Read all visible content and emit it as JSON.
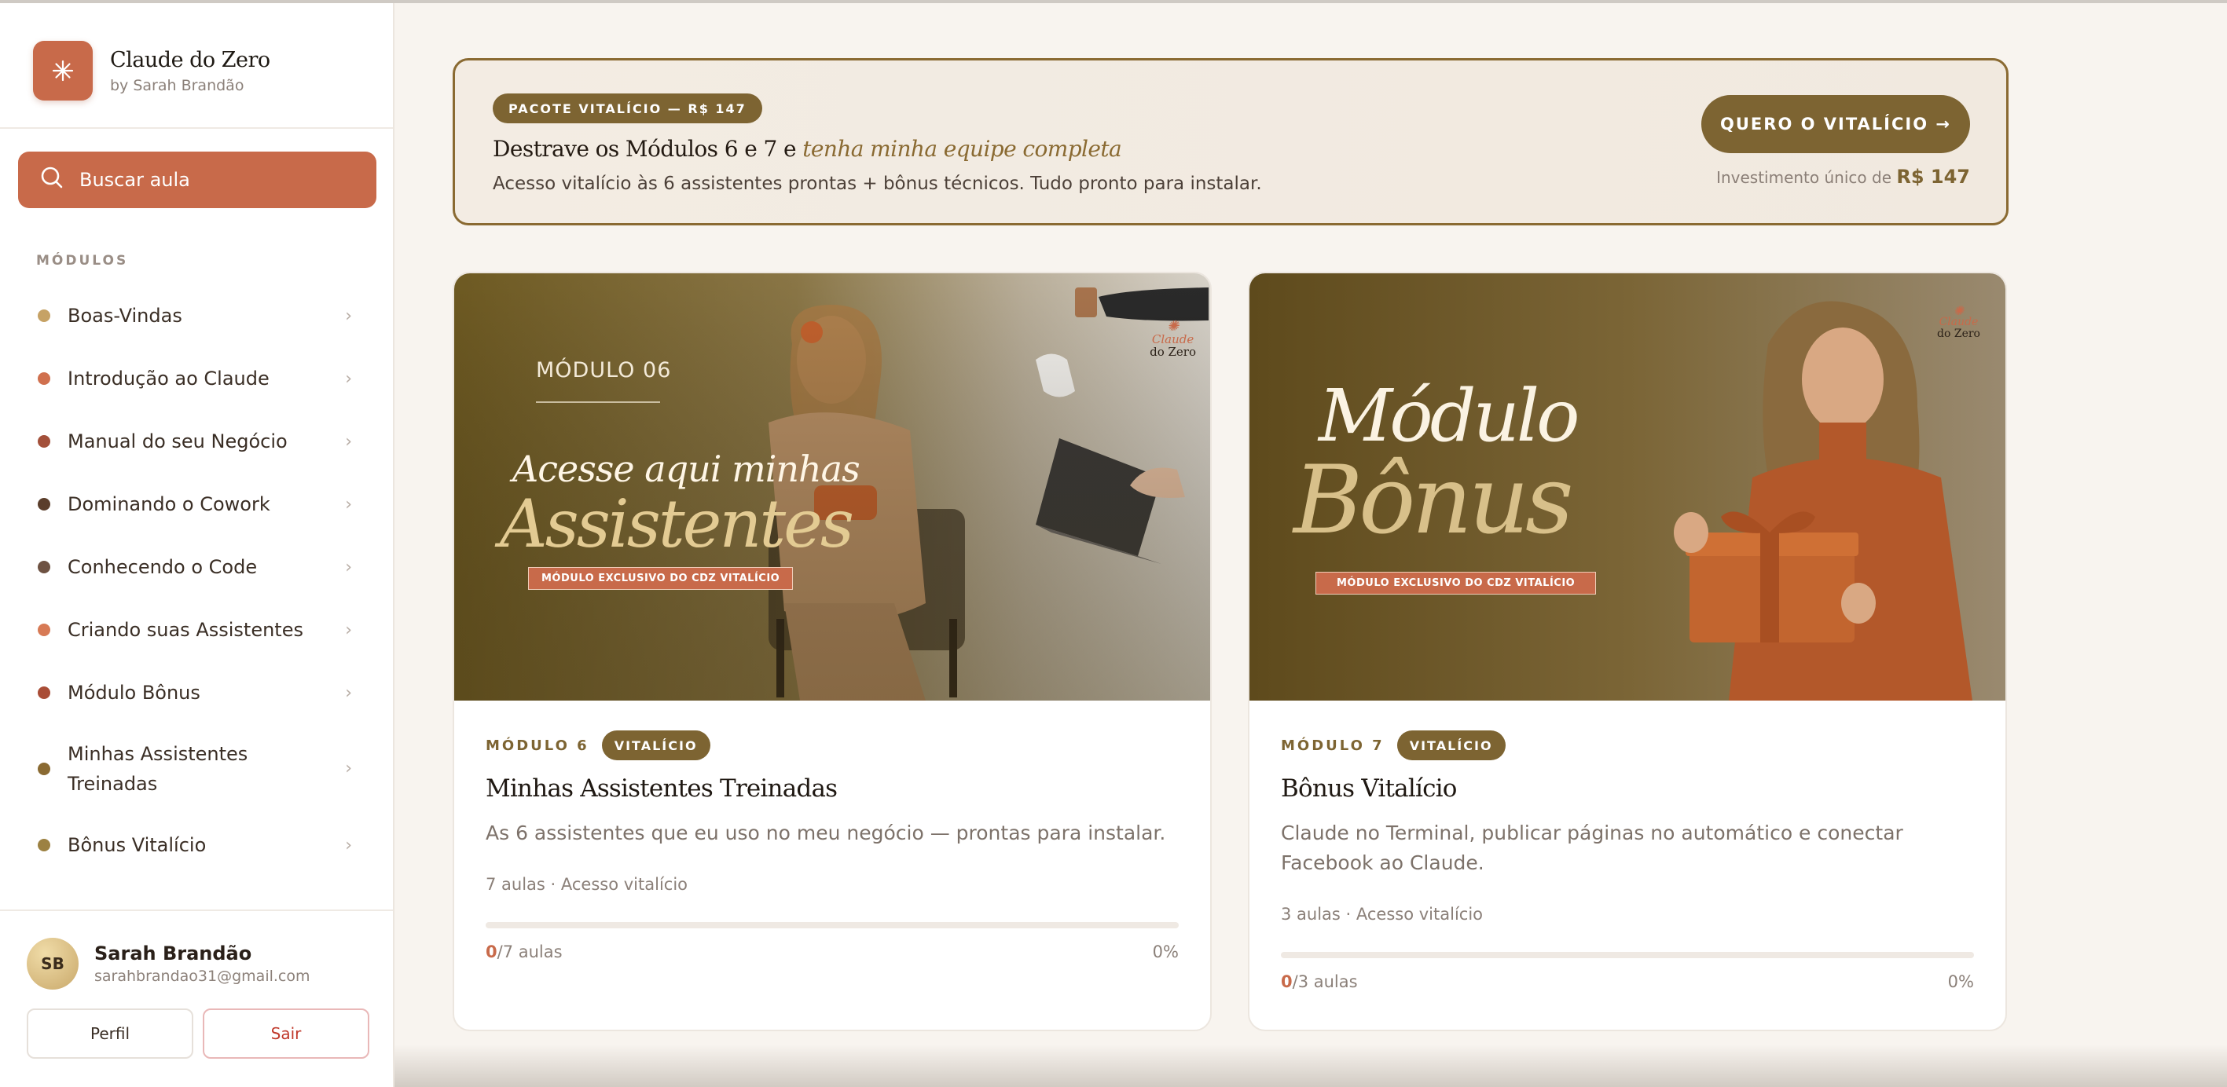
{
  "brand": {
    "title": "Claude do Zero",
    "subtitle": "by Sarah Brandão"
  },
  "search": {
    "label": "Buscar aula"
  },
  "sidebar": {
    "section_title": "MÓDULOS",
    "items": [
      {
        "label": "Boas-Vindas",
        "dot": "#c6a265"
      },
      {
        "label": "Introdução ao Claude",
        "dot": "#d0704e"
      },
      {
        "label": "Manual do seu Negócio",
        "dot": "#a3503a"
      },
      {
        "label": "Dominando o Cowork",
        "dot": "#5b3e2b"
      },
      {
        "label": "Conhecendo o Code",
        "dot": "#6e5242"
      },
      {
        "label": "Criando suas Assistentes",
        "dot": "#d77a55"
      },
      {
        "label": "Módulo Bônus",
        "dot": "#a94d36"
      },
      {
        "label": "Minhas Assistentes Treinadas",
        "dot": "#8a6a32"
      },
      {
        "label": "Bônus Vitalício",
        "dot": "#9c8142"
      }
    ]
  },
  "user": {
    "initials": "SB",
    "name": "Sarah Brandão",
    "email": "sarahbrandao31@gmail.com",
    "profile_label": "Perfil",
    "logout_label": "Sair"
  },
  "promo": {
    "badge": "PACOTE VITALÍCIO — R$ 147",
    "title_plain": "Destrave os Módulos 6 e 7 e ",
    "title_accent": "tenha minha equipe completa",
    "description": "Acesso vitalício às 6 assistentes prontas + bônus técnicos. Tudo pronto para instalar.",
    "cta": "QUERO O VITALÍCIO →",
    "price_prefix": "Investimento único de ",
    "price": "R$ 147"
  },
  "cards": [
    {
      "image": {
        "module_tag": "MÓDULO 06",
        "line1": "Acesse aqui minhas",
        "line2": "Assistentes",
        "ribbon": "MÓDULO EXCLUSIVO DO CDZ VITALÍCIO",
        "logo_line1": "Claude",
        "logo_line2": "do Zero"
      },
      "module_label": "MÓDULO 6",
      "badge": "VITALÍCIO",
      "title": "Minhas Assistentes Treinadas",
      "description": "As 6 assistentes que eu uso no meu negócio — prontas para instalar.",
      "count": "7 aulas · Acesso vitalício",
      "progress_done": "0",
      "progress_total": "/7 aulas",
      "progress_percent": "0%",
      "progress": 0
    },
    {
      "image": {
        "line1": "Módulo",
        "line2": "Bônus",
        "ribbon": "MÓDULO EXCLUSIVO DO CDZ VITALÍCIO",
        "logo_line1": "Claude",
        "logo_line2": "do Zero"
      },
      "module_label": "MÓDULO 7",
      "badge": "VITALÍCIO",
      "title": "Bônus Vitalício",
      "description": "Claude no Terminal, publicar páginas no automático e conectar Facebook ao Claude.",
      "count": "3 aulas · Acesso vitalício",
      "progress_done": "0",
      "progress_total": "/3 aulas",
      "progress_percent": "0%",
      "progress": 0
    }
  ],
  "colors": {
    "accent": "#c86a4a",
    "gold": "#7d6432",
    "background": "#f8f4ef"
  }
}
